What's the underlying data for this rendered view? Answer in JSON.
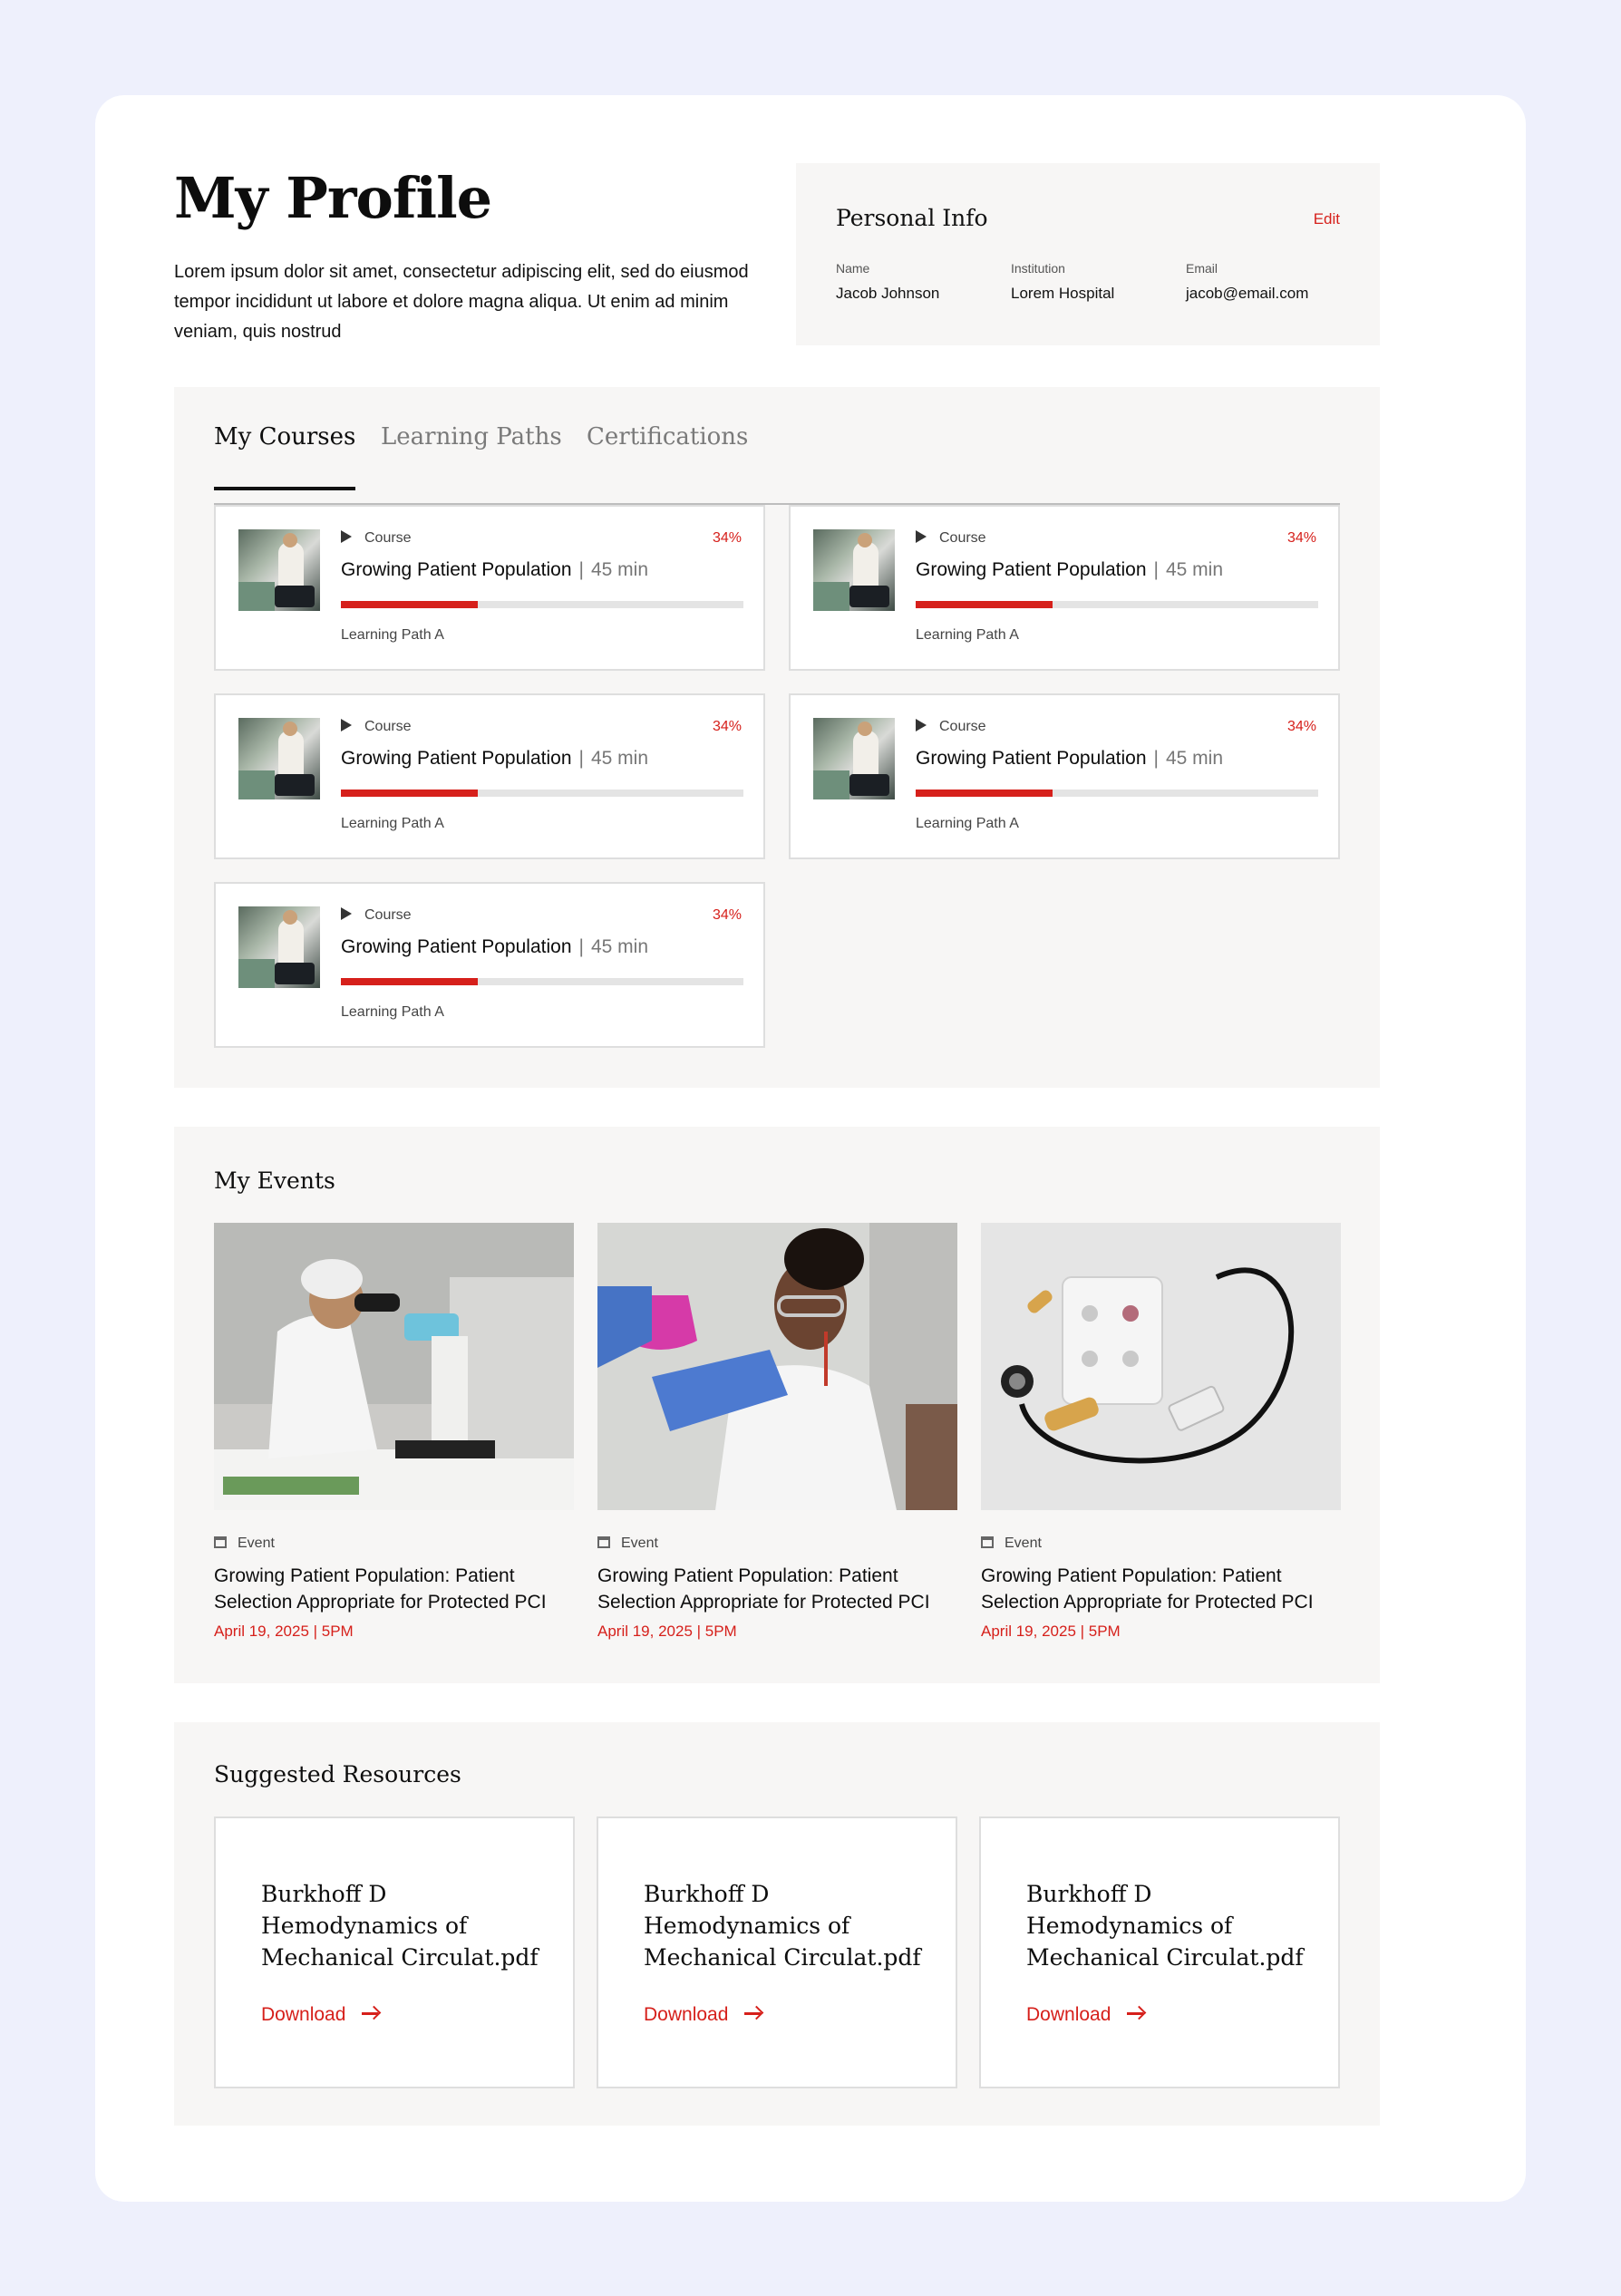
{
  "header": {
    "title": "My Profile",
    "description": "Lorem ipsum dolor sit amet, consectetur adipiscing elit, sed do eiusmod tempor incididunt ut labore et dolore magna aliqua. Ut enim ad minim veniam, quis nostrud"
  },
  "personal_info": {
    "title": "Personal Info",
    "edit_label": "Edit",
    "fields": [
      {
        "label": "Name",
        "value": "Jacob Johnson"
      },
      {
        "label": "Institution",
        "value": "Lorem Hospital"
      },
      {
        "label": "Email",
        "value": "jacob@email.com"
      }
    ]
  },
  "tabs": [
    "My Courses",
    "Learning Paths",
    "Certifications"
  ],
  "active_tab": "My Courses",
  "courses": [
    {
      "kind": "Course",
      "percent": "34%",
      "progress": 0.34,
      "title": "Growing Patient Population",
      "duration": "45 min",
      "path": "Learning Path A"
    },
    {
      "kind": "Course",
      "percent": "34%",
      "progress": 0.34,
      "title": "Growing Patient Population",
      "duration": "45 min",
      "path": "Learning Path A"
    },
    {
      "kind": "Course",
      "percent": "34%",
      "progress": 0.34,
      "title": "Growing Patient Population",
      "duration": "45 min",
      "path": "Learning Path A"
    },
    {
      "kind": "Course",
      "percent": "34%",
      "progress": 0.34,
      "title": "Growing Patient Population",
      "duration": "45 min",
      "path": "Learning Path A"
    },
    {
      "kind": "Course",
      "percent": "34%",
      "progress": 0.34,
      "title": "Growing Patient Population",
      "duration": "45 min",
      "path": "Learning Path A"
    }
  ],
  "events": {
    "title": "My Events",
    "items": [
      {
        "kind": "Event",
        "title": "Growing Patient Population: Patient Selection Appropriate for Protected PCI",
        "date": "April 19, 2025  |  5PM"
      },
      {
        "kind": "Event",
        "title": "Growing Patient Population: Patient Selection Appropriate for Protected PCI",
        "date": "April 19, 2025  |  5PM"
      },
      {
        "kind": "Event",
        "title": "Growing Patient Population: Patient Selection Appropriate for Protected PCI",
        "date": "April 19, 2025  |  5PM"
      }
    ]
  },
  "resources": {
    "title": "Suggested Resources",
    "items": [
      {
        "title": "Burkhoff D Hemodynamics of Mechanical Circulat.pdf",
        "action": "Download"
      },
      {
        "title": "Burkhoff D Hemodynamics of Mechanical Circulat.pdf",
        "action": "Download"
      },
      {
        "title": "Burkhoff D Hemodynamics of Mechanical Circulat.pdf",
        "action": "Download"
      }
    ]
  },
  "colors": {
    "accent": "#d6201b",
    "page_bg": "#eef0fc",
    "panel_bg": "#f7f6f5"
  }
}
